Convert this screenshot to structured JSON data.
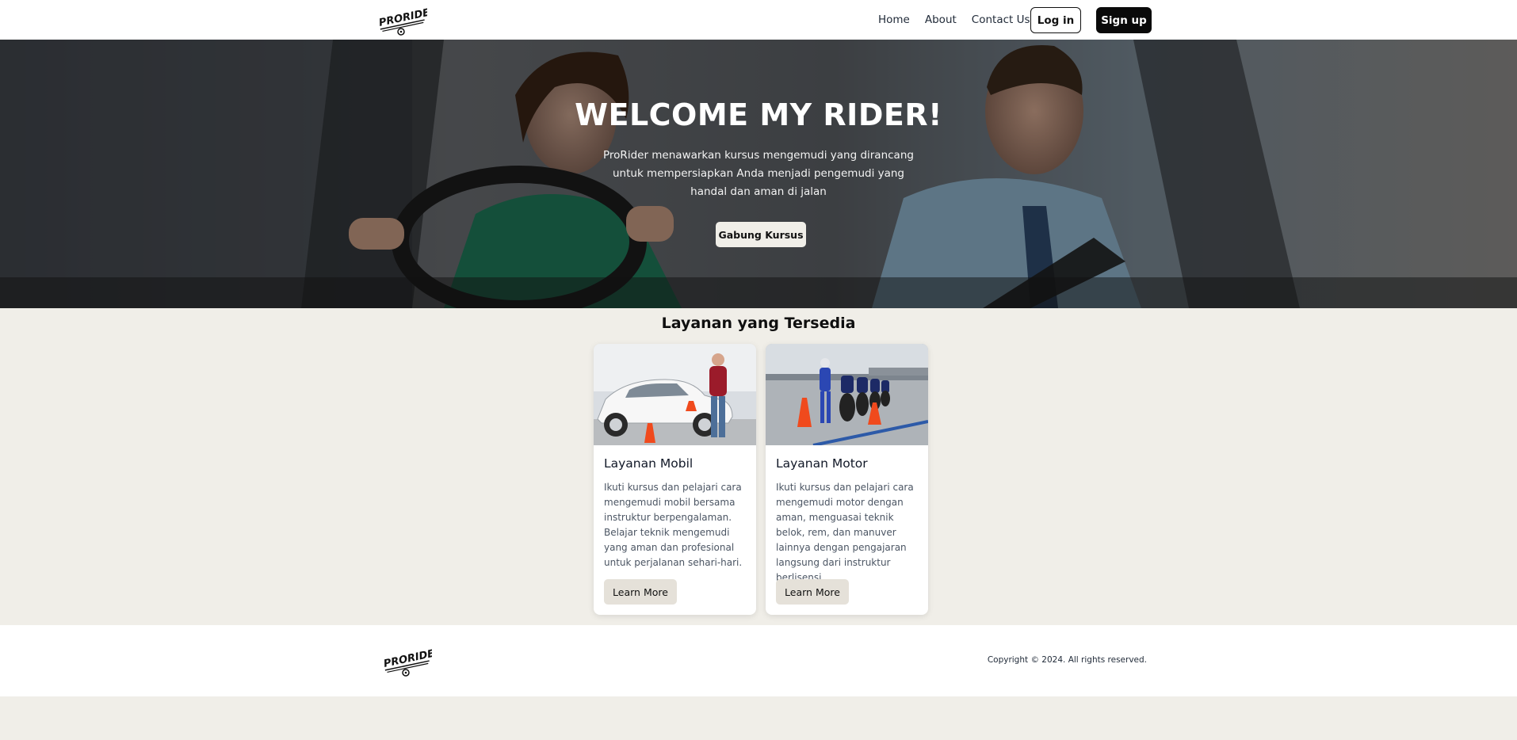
{
  "nav": {
    "logo_text": "PRORIDER",
    "links": [
      "Home",
      "About",
      "Contact Us"
    ],
    "login_label": "Log in",
    "signup_label": "Sign up"
  },
  "hero": {
    "title": "WELCOME MY RIDER!",
    "description": "ProRider menawarkan kursus mengemudi yang dirancang untuk mempersiapkan Anda menjadi pengemudi yang handal dan aman di jalan",
    "cta_label": "Gabung Kursus",
    "image": "car-driving-lesson-photo"
  },
  "services": {
    "title": "Layanan yang Tersedia",
    "cards": [
      {
        "title": "Layanan Mobil",
        "text": "Ikuti kursus dan pelajari cara mengemudi mobil bersama instruktur berpengalaman. Belajar teknik mengemudi yang aman dan profesional untuk perjalanan sehari-hari.",
        "button": "Learn More",
        "image": "car-instructor-photo"
      },
      {
        "title": "Layanan Motor",
        "text": "Ikuti kursus dan pelajari cara mengemudi motor dengan aman, menguasai teknik belok, rem, dan manuver lainnya dengan pengajaran langsung dari instruktur berlisensi.",
        "button": "Learn More",
        "image": "motorcycle-training-photo"
      }
    ]
  },
  "footer": {
    "logo_text": "PRORIDER",
    "copyright": "Copyright © 2024. All rights reserved."
  },
  "colors": {
    "page_bg": "#f0eee8",
    "nav_bg": "#ffffff",
    "accent_dark": "#0a0a0a",
    "card_button_bg": "#e5e1d9"
  }
}
